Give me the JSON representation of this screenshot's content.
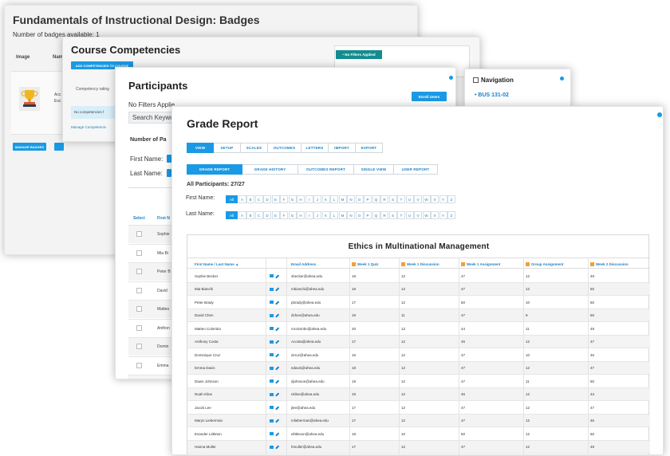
{
  "badges_window": {
    "title": "Fundamentals of Instructional Design: Badges",
    "subtitle": "Number of badges available: 1",
    "header_image": "Image",
    "header_name": "Nam",
    "badge_text_1": "Acc",
    "badge_text_2": "Exc",
    "manage_button": "MANAGE BADGES"
  },
  "competencies_window": {
    "title": "Course Competencies",
    "add_button": "ADD COMPETENCIES TO COURSE",
    "rating_label": "Competency rating",
    "no_competencies": "No competencies f",
    "manage_link": "Manage Competencie",
    "filter_chip": "• No Filters Applied"
  },
  "navigation_window": {
    "title": "Navigation",
    "link": "• BUS 131-02"
  },
  "participants_window": {
    "title": "Participants",
    "no_filters": "No Filters Applie",
    "search_value": "Search Keywo",
    "number_label": "Number of Pa",
    "first_name_label": "First Name:",
    "last_name_label": "Last Name:",
    "enroll_button": "Enroll Users",
    "col_select": "Select",
    "col_first": "First N",
    "rows": [
      "Sophie",
      "Mia Bi",
      "Peter B",
      "David",
      "Matteo",
      "Anthon",
      "Domin",
      "Emma",
      "Bradfo"
    ]
  },
  "grade_report": {
    "title": "Grade Report",
    "top_tabs": [
      "VIEW",
      "SETUP",
      "SCALES",
      "OUTCOMES",
      "LETTERS",
      "IMPORT",
      "EXPORT"
    ],
    "sub_tabs": [
      "GRADE REPORT",
      "GRADE HISTORY",
      "OUTCOMES REPORT",
      "SINGLE VIEW",
      "USER REPORT"
    ],
    "all_participants": "All Participants: 27/27",
    "first_name_label": "First Name:",
    "last_name_label": "Last Name:",
    "letters": [
      "All",
      "A",
      "B",
      "C",
      "D",
      "E",
      "F",
      "G",
      "H",
      "I",
      "J",
      "K",
      "L",
      "M",
      "N",
      "O",
      "P",
      "Q",
      "R",
      "S",
      "T",
      "U",
      "V",
      "W",
      "X",
      "Y",
      "Z"
    ],
    "course_title": "Ethics in Multinational Management",
    "columns": {
      "name": "First Name / Last Name ▲",
      "email": "Email Address",
      "w1_quiz": "Week 1 Quiz",
      "w1_disc": "Week 1 Discussion",
      "w1_assign": "Week 1 Assignment",
      "group_assign": "Group Assignment",
      "w2_disc": "Week 2 Discussion"
    },
    "colors": {
      "accent": "#1a9ae4",
      "link": "#1a7fc4",
      "grade_icon": "#f0a03a"
    },
    "students": [
      {
        "name": "Sophie Becker",
        "email": "sbecker@ahea.edu",
        "q": "18",
        "d": "12",
        "a": "47",
        "g": "12",
        "d2": "49"
      },
      {
        "name": "Mia Bianchi",
        "email": "mbianchi@ahea.edu",
        "q": "18",
        "d": "12",
        "a": "47",
        "g": "12",
        "d2": "50"
      },
      {
        "name": "Peter Brady",
        "email": "pbrady@ahea.edu",
        "q": "17",
        "d": "12",
        "a": "50",
        "g": "10",
        "d2": "50"
      },
      {
        "name": "David Chen",
        "email": "dchen@ahea.edu",
        "q": "19",
        "d": "11",
        "a": "47",
        "g": "9",
        "d2": "50"
      },
      {
        "name": "Matteo Colombo",
        "email": "mcolombo@ahea.edu",
        "q": "20",
        "d": "12",
        "a": "44",
        "g": "11",
        "d2": "48"
      },
      {
        "name": "Anthony Costa",
        "email": "Acosta@ahea.edu",
        "q": "17",
        "d": "12",
        "a": "45",
        "g": "12",
        "d2": "47"
      },
      {
        "name": "Dominique Cruz",
        "email": "dcruz@ahea.edu",
        "q": "16",
        "d": "12",
        "a": "47",
        "g": "10",
        "d2": "46"
      },
      {
        "name": "Emma Davis",
        "email": "edavis@ahea.edu",
        "q": "18",
        "d": "12",
        "a": "47",
        "g": "12",
        "d2": "47"
      },
      {
        "name": "Dawn Johnson",
        "email": "djohnson@ahea.edu",
        "q": "19",
        "d": "12",
        "a": "47",
        "g": "11",
        "d2": "50"
      },
      {
        "name": "Noah Kline",
        "email": "nkline@ahea.edu",
        "q": "19",
        "d": "12",
        "a": "46",
        "g": "12",
        "d2": "43"
      },
      {
        "name": "Jacob Lee",
        "email": "jlee@ahea.edu",
        "q": "17",
        "d": "12",
        "a": "47",
        "g": "12",
        "d2": "47"
      },
      {
        "name": "Maryn Lieberman",
        "email": "mlieberman@ahea.edu",
        "q": "17",
        "d": "12",
        "a": "47",
        "g": "12",
        "d2": "46"
      },
      {
        "name": "Evander Littleton",
        "email": "elittleson@ahea.edu",
        "q": "18",
        "d": "10",
        "a": "50",
        "g": "12",
        "d2": "50"
      },
      {
        "name": "Hanna Muller",
        "email": "hmuller@ahea.edu",
        "q": "17",
        "d": "12",
        "a": "47",
        "g": "12",
        "d2": "49"
      }
    ]
  }
}
